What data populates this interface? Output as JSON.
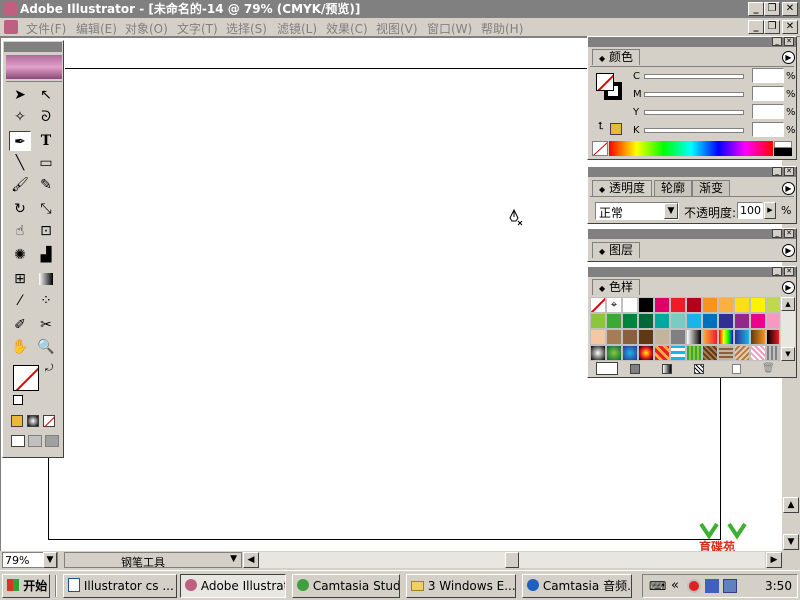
{
  "window": {
    "title": "Adobe Illustrator - [未命名的-14 @ 79% (CMYK/预览)]"
  },
  "menu": [
    {
      "label": "文件(F)"
    },
    {
      "label": "编辑(E)"
    },
    {
      "label": "对象(O)"
    },
    {
      "label": "文字(T)"
    },
    {
      "label": "选择(S)"
    },
    {
      "label": "滤镜(L)"
    },
    {
      "label": "效果(C)"
    },
    {
      "label": "视图(V)"
    },
    {
      "label": "窗口(W)"
    },
    {
      "label": "帮助(H)"
    }
  ],
  "color_panel": {
    "title": "颜色",
    "channels": [
      {
        "label": "C"
      },
      {
        "label": "M"
      },
      {
        "label": "Y"
      },
      {
        "label": "K"
      }
    ],
    "unit": "%"
  },
  "transparency_panel": {
    "tabs": [
      {
        "label": "透明度"
      },
      {
        "label": "轮廓"
      },
      {
        "label": "渐变"
      }
    ],
    "blend_mode": "正常",
    "opacity_label": "不透明度:",
    "opacity_value": "100",
    "unit": "%"
  },
  "layers_panel": {
    "title": "图层"
  },
  "swatches_panel": {
    "title": "色样"
  },
  "status": {
    "zoom": "79%",
    "tool": "钢笔工具"
  },
  "watermark": {
    "text": "育碟苑"
  },
  "taskbar": {
    "start": "开始",
    "tasks": [
      {
        "label": "Illustrator cs ..."
      },
      {
        "label": "Adobe Illustrat..."
      },
      {
        "label": "Camtasia Studi..."
      },
      {
        "label": "3 Windows E..."
      },
      {
        "label": "Camtasia 音频..."
      }
    ],
    "time": "3:50"
  },
  "colors": {
    "brand_accent": "#e8ba3a",
    "title_inactive": "#808080"
  },
  "icons": {
    "selection": "selection-arrow-icon",
    "direct_selection": "direct-selection-icon",
    "magic_wand": "magic-wand-icon",
    "lasso": "lasso-icon",
    "pen": "pen-icon",
    "type": "type-icon",
    "line": "line-segment-icon",
    "rectangle": "rectangle-icon",
    "paintbrush": "paintbrush-icon",
    "pencil": "pencil-icon",
    "rotate": "rotate-icon",
    "scale": "scale-icon",
    "warp": "warp-icon",
    "free_transform": "free-transform-icon",
    "symbol_sprayer": "symbol-sprayer-icon",
    "graph": "column-graph-icon",
    "mesh": "mesh-icon",
    "gradient": "gradient-icon",
    "eyedropper": "eyedropper-icon",
    "blend": "blend-icon",
    "slice": "slice-icon",
    "scissors": "scissors-icon",
    "hand": "hand-icon",
    "zoom": "zoom-icon"
  }
}
